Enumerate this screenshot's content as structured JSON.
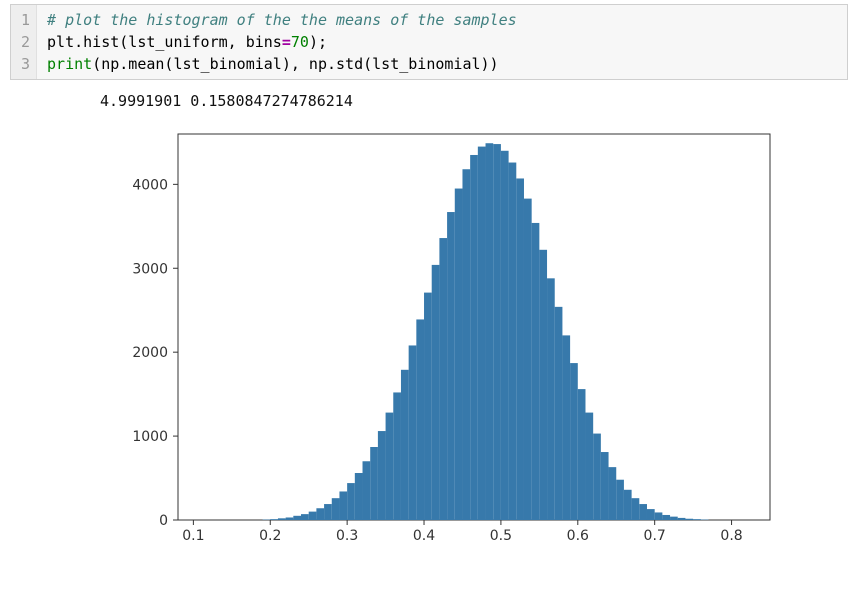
{
  "code": {
    "line_numbers": [
      "1",
      "2",
      "3"
    ],
    "line1_comment": "# plot the histogram of the the means of the samples",
    "line2_a": "plt.hist(lst_uniform, bins",
    "line2_eq": "=",
    "line2_num": "70",
    "line2_b": ");",
    "line3_print": "print",
    "line3_rest": "(np.mean(lst_binomial), np.std(lst_binomial))"
  },
  "output_text": "4.9991901 0.1580847274786214",
  "chart_data": {
    "type": "bar",
    "title": "",
    "xlabel": "",
    "ylabel": "",
    "xlim": [
      0.08,
      0.85
    ],
    "ylim": [
      0,
      4600
    ],
    "xticks": [
      0.1,
      0.2,
      0.3,
      0.4,
      0.5,
      0.6,
      0.7,
      0.8
    ],
    "yticks": [
      0,
      1000,
      2000,
      3000,
      4000
    ],
    "categories": [
      0.1,
      0.11,
      0.12,
      0.13,
      0.14,
      0.15,
      0.16,
      0.17,
      0.18,
      0.19,
      0.2,
      0.21,
      0.22,
      0.23,
      0.24,
      0.25,
      0.26,
      0.27,
      0.28,
      0.29,
      0.3,
      0.31,
      0.32,
      0.33,
      0.34,
      0.35,
      0.36,
      0.37,
      0.38,
      0.39,
      0.4,
      0.41,
      0.42,
      0.43,
      0.44,
      0.45,
      0.46,
      0.47,
      0.48,
      0.49,
      0.5,
      0.51,
      0.52,
      0.53,
      0.54,
      0.55,
      0.56,
      0.57,
      0.58,
      0.59,
      0.6,
      0.61,
      0.62,
      0.63,
      0.64,
      0.65,
      0.66,
      0.67,
      0.68,
      0.69,
      0.7,
      0.71,
      0.72,
      0.73,
      0.74,
      0.75,
      0.76,
      0.77,
      0.78,
      0.79
    ],
    "values": [
      0,
      0,
      0,
      0,
      0,
      0,
      0,
      0,
      0,
      5,
      10,
      20,
      30,
      50,
      70,
      100,
      140,
      190,
      260,
      340,
      440,
      560,
      700,
      870,
      1060,
      1280,
      1520,
      1790,
      2080,
      2390,
      2710,
      3040,
      3360,
      3670,
      3950,
      4180,
      4350,
      4450,
      4490,
      4480,
      4400,
      4260,
      4070,
      3830,
      3540,
      3220,
      2880,
      2540,
      2200,
      1870,
      1560,
      1280,
      1030,
      810,
      630,
      480,
      360,
      260,
      190,
      130,
      90,
      60,
      40,
      25,
      15,
      10,
      5,
      0,
      0,
      0
    ]
  }
}
